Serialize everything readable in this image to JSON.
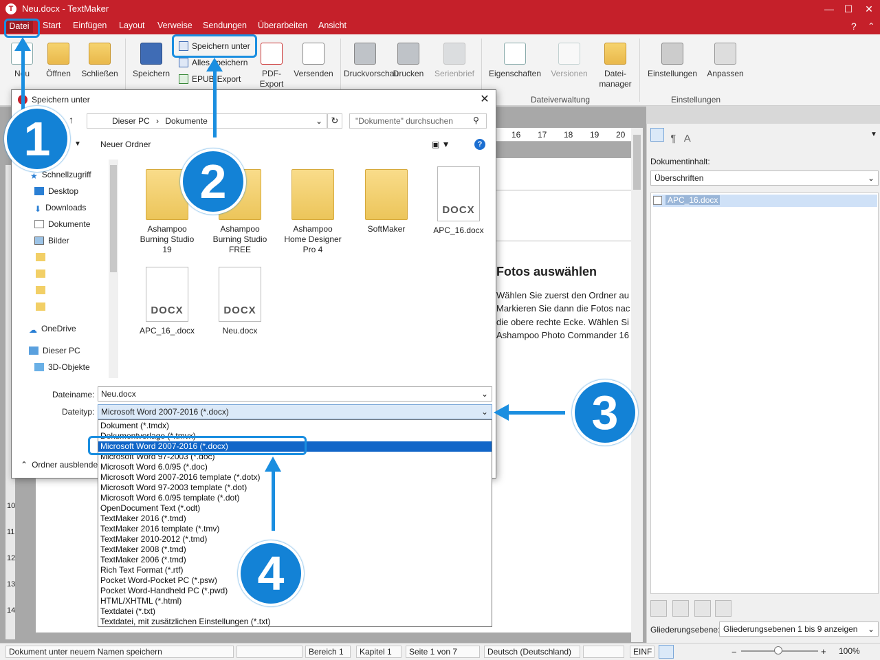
{
  "window": {
    "title": "Neu.docx - TextMaker",
    "help": "?"
  },
  "menu": [
    "Datei",
    "Start",
    "Einfügen",
    "Layout",
    "Verweise",
    "Sendungen",
    "Überarbeiten",
    "Ansicht"
  ],
  "ribbon": {
    "neu": "Neu",
    "oeffnen": "Öffnen",
    "schliessen": "Schließen",
    "speichern": "Speichern",
    "speichern_unter": "Speichern unter",
    "alles_speichern": "Alles speichern",
    "epub_export": "EPUB-Export",
    "pdf_export": "PDF-Export",
    "versenden": "Versenden",
    "druckvorschau": "Druckvorschau",
    "drucken": "Drucken",
    "serienbrief": "Serienbrief",
    "eigenschaften": "Eigenschaften",
    "versionen": "Versionen",
    "dateimanager": "Datei-manager",
    "einstellungen": "Einstellungen",
    "anpassen": "Anpassen",
    "group_dateiverwaltung": "Dateiverwaltung",
    "group_einstellungen": "Einstellungen"
  },
  "dialog": {
    "title": "Speichern unter",
    "breadcrumb": [
      "Dieser PC",
      "Dokumente"
    ],
    "search_placeholder": "\"Dokumente\" durchsuchen",
    "new_folder": "Neuer Ordner",
    "nav": {
      "quick": "Schnellzugriff",
      "desktop": "Desktop",
      "downloads": "Downloads",
      "dokumente": "Dokumente",
      "bilder": "Bilder",
      "onedrive": "OneDrive",
      "dieserpc": "Dieser PC",
      "objekte": "3D-Objekte"
    },
    "files": [
      {
        "name": "Ashampoo Burning Studio 19",
        "type": "folder"
      },
      {
        "name": "Ashampoo Burning Studio FREE",
        "type": "folder"
      },
      {
        "name": "Ashampoo Home Designer Pro 4",
        "type": "folder"
      },
      {
        "name": "SoftMaker",
        "type": "folder"
      },
      {
        "name": "APC_16.docx",
        "type": "docx"
      },
      {
        "name": "APC_16_.docx",
        "type": "docx"
      },
      {
        "name": "Neu.docx",
        "type": "docx"
      }
    ],
    "docx_label": "DOCX",
    "filename_label": "Dateiname:",
    "filename_value": "Neu.docx",
    "filetype_label": "Dateityp:",
    "filetype_value": "Microsoft Word 2007-2016 (*.docx)",
    "hide_folders": "Ordner ausblenden",
    "filetype_options": [
      "Dokument (*.tmdx)",
      "Dokumentvorlage (*.tmvx)",
      "Microsoft Word 2007-2016 (*.docx)",
      "Microsoft Word 97-2003 (*.doc)",
      "Microsoft Word 6.0/95 (*.doc)",
      "Microsoft Word 2007-2016 template (*.dotx)",
      "Microsoft Word 97-2003 template (*.dot)",
      "Microsoft Word 6.0/95 template (*.dot)",
      "OpenDocument Text (*.odt)",
      "TextMaker 2016 (*.tmd)",
      "TextMaker 2016 template (*.tmv)",
      "TextMaker 2010-2012 (*.tmd)",
      "TextMaker 2008 (*.tmd)",
      "TextMaker 2006 (*.tmd)",
      "Rich Text Format (*.rtf)",
      "Pocket Word-Pocket PC (*.psw)",
      "Pocket Word-Handheld PC (*.pwd)",
      "HTML/XHTML (*.html)",
      "Textdatei (*.txt)",
      "Textdatei, mit zusätzlichen Einstellungen (*.txt)"
    ],
    "selected_option_index": 2
  },
  "document": {
    "ruler": [
      "16",
      "17",
      "18",
      "19",
      "20"
    ],
    "left_ruler": [
      "10",
      "11",
      "12",
      "13",
      "14"
    ],
    "heading": "Fotos auswählen",
    "lines": [
      "Wählen Sie zuerst den Ordner au",
      "Markieren Sie dann die Fotos nac",
      "die obere rechte Ecke. Wählen Si",
      "Ashampoo Photo Commander 16"
    ]
  },
  "right_pane": {
    "label": "Dokumentinhalt:",
    "select": "Überschriften",
    "item": "APC_16.docx",
    "level_label": "Gliederungsebene:",
    "level_value": "Gliederungsebenen 1 bis 9 anzeigen"
  },
  "status": {
    "message": "Dokument unter neuem Namen speichern",
    "bereich": "Bereich 1",
    "kapitel": "Kapitel 1",
    "seite": "Seite 1 von 7",
    "sprache": "Deutsch (Deutschland)",
    "mode": "EINF",
    "zoom": "100%"
  },
  "callouts": [
    "1",
    "2",
    "3",
    "4"
  ],
  "colors": {
    "titlebar": "#c5202a",
    "callout": "#1382d6",
    "selection": "#1166c8"
  }
}
